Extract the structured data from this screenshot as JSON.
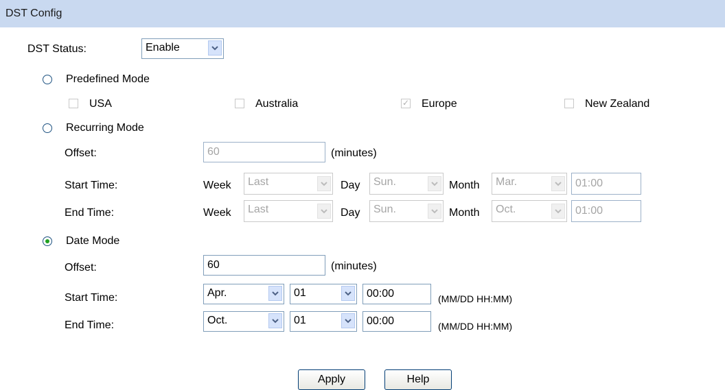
{
  "header": {
    "title": "DST Config"
  },
  "dst_status": {
    "label": "DST Status:",
    "value": "Enable"
  },
  "predefined": {
    "label": "Predefined Mode",
    "options": [
      {
        "label": "USA",
        "checked": false
      },
      {
        "label": "Australia",
        "checked": false
      },
      {
        "label": "Europe",
        "checked": true
      },
      {
        "label": "New Zealand",
        "checked": false
      }
    ]
  },
  "recurring": {
    "label": "Recurring Mode",
    "offset_label": "Offset:",
    "offset_value": "60",
    "unit": "(minutes)",
    "week_label": "Week",
    "day_label": "Day",
    "month_label": "Month",
    "start": {
      "label": "Start Time:",
      "week": "Last",
      "day": "Sun.",
      "month": "Mar.",
      "time": "01:00"
    },
    "end": {
      "label": "End Time:",
      "week": "Last",
      "day": "Sun.",
      "month": "Oct.",
      "time": "01:00"
    }
  },
  "date_mode": {
    "label": "Date Mode",
    "selected": true,
    "offset_label": "Offset:",
    "offset_value": "60",
    "unit": "(minutes)",
    "format": "(MM/DD HH:MM)",
    "start": {
      "label": "Start Time:",
      "month": "Apr.",
      "day": "01",
      "time": "00:00"
    },
    "end": {
      "label": "End Time:",
      "month": "Oct.",
      "day": "01",
      "time": "00:00"
    }
  },
  "buttons": {
    "apply": "Apply",
    "help": "Help"
  },
  "colors": {
    "header_bg": "#c9d9f0",
    "radio_dot": "#21a121",
    "field_border": "#7f9db9"
  }
}
